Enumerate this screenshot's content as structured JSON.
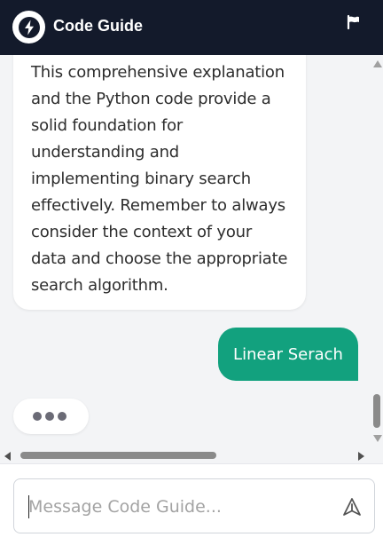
{
  "header": {
    "title": "Code Guide",
    "logo_icon": "lightning-bolt-icon",
    "flag_icon": "flag-icon"
  },
  "messages": {
    "bot_text": "This comprehensive explanation and the Python code provide a solid foundation for understanding and implementing binary search effectively. Remember to always consider the context of your data and choose the appropriate search algorithm.",
    "user_text": "Linear Serach"
  },
  "composer": {
    "placeholder": "Message Code Guide...",
    "value": "",
    "send_icon": "send-icon"
  },
  "colors": {
    "header_bg": "#131a2b",
    "user_bubble": "#12a17e",
    "page_bg": "#f3f4f6"
  }
}
